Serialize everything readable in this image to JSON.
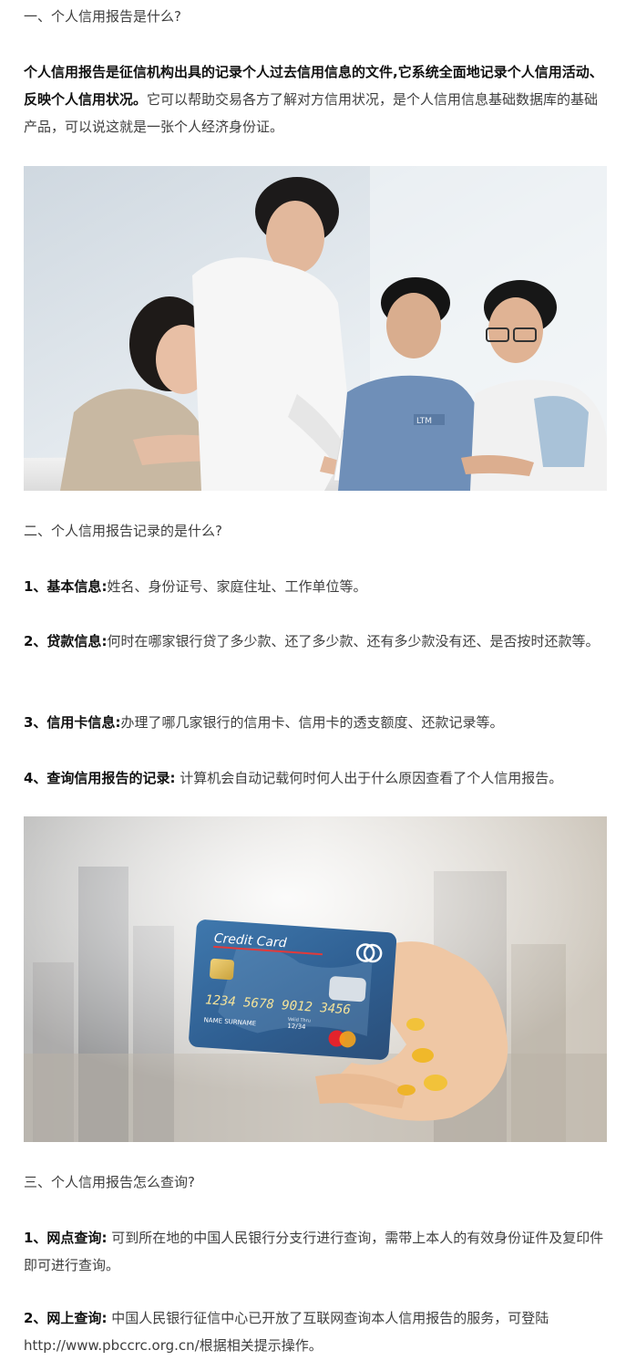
{
  "section1": {
    "heading": "一、个人信用报告是什么?",
    "intro_bold": "个人信用报告是征信机构出具的记录个人过去信用信息的文件,它系统全面地记录个人信用活动、反映个人信用状况。",
    "intro_text": "它可以帮助交易各方了解对方信用状况，是个人信用信息基础数据库的基础产品，可以说这就是一张个人经济身份证。"
  },
  "photo_meeting": {
    "shirt_label": "LTM"
  },
  "section2": {
    "heading": "二、个人信用报告记录的是什么?",
    "items": [
      {
        "label": "1、基本信息:",
        "text": "姓名、身份证号、家庭住址、工作单位等。"
      },
      {
        "label": "2、贷款信息:",
        "text": "何时在哪家银行贷了多少款、还了多少款、还有多少款没有还、是否按时还款等。"
      },
      {
        "label": "3、信用卡信息:",
        "text": "办理了哪几家银行的信用卡、信用卡的透支额度、还款记录等。"
      },
      {
        "label": "4、查询信用报告的记录:",
        "text": " 计算机会自动记载何时何人出于什么原因查看了个人信用报告。"
      }
    ]
  },
  "photo_card": {
    "card_title": "Credit Card",
    "card_number": "1234 5678 9012 3456",
    "card_name": "NAME  SURNAME",
    "card_valid_small": "Valid Thru",
    "card_date": "12/34"
  },
  "section3": {
    "heading": "三、个人信用报告怎么查询?",
    "items": [
      {
        "label": "1、网点查询:",
        "text": " 可到所在地的中国人民银行分支行进行查询，需带上本人的有效身份证件及复印件即可进行查询。"
      },
      {
        "label": "2、网上查询:",
        "text": " 中国人民银行征信中心已开放了互联网查询本人信用报告的服务，可登陆http://www.pbccrc.org.cn/根据相关提示操作。"
      }
    ]
  }
}
